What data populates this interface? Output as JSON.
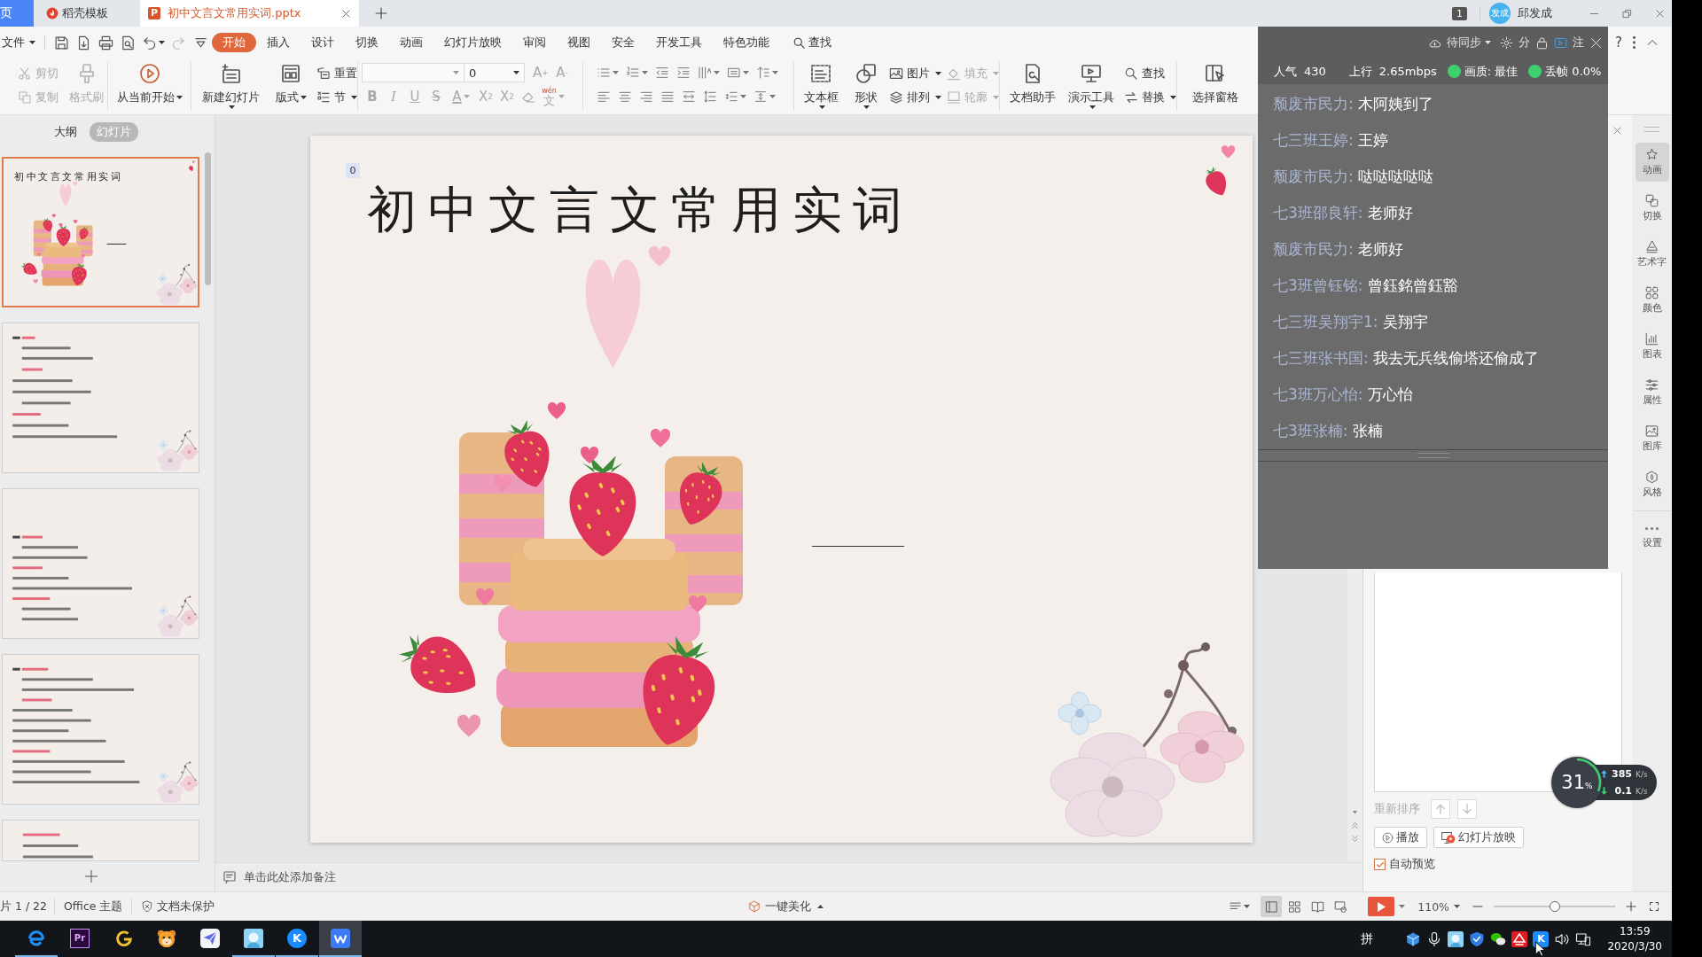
{
  "tabs": [
    {
      "kind": "home",
      "label": "页",
      "selected": false
    },
    {
      "kind": "docer",
      "label": "稻壳模板",
      "selected": false
    },
    {
      "kind": "pptx",
      "glyph": "P",
      "label": "初中文言文常用实词.pptx",
      "selected": true
    }
  ],
  "account": {
    "count": "1",
    "avatar": "发成",
    "name": "邱发成"
  },
  "menu": {
    "file": "文件",
    "tabs": [
      {
        "label": "开始",
        "selected": true
      },
      {
        "label": "插入",
        "selected": false
      },
      {
        "label": "设计",
        "selected": false
      },
      {
        "label": "切换",
        "selected": false
      },
      {
        "label": "动画",
        "selected": false
      },
      {
        "label": "幻灯片放映",
        "selected": false
      },
      {
        "label": "审阅",
        "selected": false
      },
      {
        "label": "视图",
        "selected": false
      },
      {
        "label": "安全",
        "selected": false
      },
      {
        "label": "开发工具",
        "selected": false
      },
      {
        "label": "特色功能",
        "selected": false
      }
    ],
    "search": "查找",
    "sync_status": "待同步",
    "share": "分",
    "comments": "注",
    "help": "?"
  },
  "ribbon": [
    [
      {
        "kind": "stack",
        "items": [
          {
            "label": "剪切",
            "disabled": true,
            "caret": false
          },
          {
            "label": "复制",
            "disabled": true,
            "caret": false
          }
        ]
      },
      {
        "kind": "large",
        "label": "格式刷",
        "disabled": true,
        "caret": false
      }
    ],
    [
      {
        "kind": "large",
        "label": "从当前开始",
        "disabled": false,
        "caret": true
      }
    ],
    [
      {
        "kind": "large",
        "label": "新建幻灯片",
        "disabled": false,
        "caret": true
      },
      {
        "kind": "large",
        "label": "版式",
        "disabled": false,
        "caret": true
      },
      {
        "kind": "stack",
        "items": [
          {
            "label": "重置",
            "disabled": false,
            "caret": false
          },
          {
            "label": "节",
            "disabled": false,
            "caret": true
          }
        ]
      }
    ],
    [
      {
        "kind": "font",
        "disabled": true,
        "size": "0",
        "grow": {
          "glyph": "A",
          "index": "+"
        },
        "shrink": {
          "glyph": "A",
          "index": "-"
        },
        "styles": [
          {
            "kind": "bold",
            "glyph": "B"
          },
          {
            "kind": "italic",
            "glyph": "I"
          },
          {
            "kind": "underline",
            "glyph": "U"
          },
          {
            "kind": "strike",
            "glyph": "S"
          },
          {
            "kind": "color",
            "glyph": "A"
          },
          {
            "kind": "sup",
            "glyph": "X",
            "index": "2"
          },
          {
            "kind": "sub",
            "glyph": "X",
            "index": "2"
          },
          {
            "kind": "eraser"
          },
          {
            "kind": "phonetic",
            "glyph": "文",
            "ruby": "wén"
          }
        ]
      }
    ],
    [
      {
        "kind": "paragraph"
      }
    ],
    [
      {
        "kind": "large",
        "label": "文本框",
        "disabled": false,
        "caret": true
      },
      {
        "kind": "large",
        "label": "形状",
        "disabled": false,
        "caret": true
      },
      {
        "kind": "stack",
        "items": [
          {
            "label": "图片",
            "disabled": false,
            "caret": true
          },
          {
            "label": "排列",
            "disabled": false,
            "caret": true
          }
        ]
      },
      {
        "kind": "stack",
        "items": [
          {
            "label": "填充",
            "disabled": true,
            "caret": true
          },
          {
            "label": "轮廓",
            "disabled": true,
            "caret": true
          }
        ]
      }
    ],
    [
      {
        "kind": "large",
        "label": "文档助手",
        "disabled": false,
        "caret": false
      },
      {
        "kind": "large",
        "label": "演示工具",
        "disabled": false,
        "caret": true
      },
      {
        "kind": "stack",
        "items": [
          {
            "label": "查找",
            "disabled": false,
            "caret": false
          },
          {
            "label": "替换",
            "disabled": false,
            "caret": true
          }
        ]
      }
    ],
    [
      {
        "kind": "large",
        "label": "选择窗格",
        "disabled": false,
        "caret": false
      }
    ]
  ],
  "slides_panel": {
    "tabs": [
      {
        "label": "大纲",
        "selected": false
      },
      {
        "label": "幻灯片",
        "selected": true
      }
    ],
    "thumbnails": [
      {
        "kind": "title",
        "title": "初中文言文常用实词",
        "selected": true
      },
      {
        "kind": "notes",
        "selected": false
      },
      {
        "kind": "notes",
        "selected": false
      },
      {
        "kind": "notes",
        "selected": false
      },
      {
        "kind": "notes",
        "selected": false
      }
    ]
  },
  "slide": {
    "badge": "0",
    "title": "初中文言文常用实词"
  },
  "notes": {
    "hint": "单击此处添加备注"
  },
  "task_pane": {
    "reorder": {
      "label": "重新排序",
      "disabled": true
    },
    "buttons": [
      {
        "kind": "play",
        "label": "播放"
      },
      {
        "kind": "slideshow",
        "label": "幻灯片放映"
      }
    ],
    "auto_preview": {
      "label": "自动预览",
      "checked": true
    }
  },
  "sidebar": [
    {
      "kind": "animation",
      "label": "动画",
      "selected": true
    },
    {
      "kind": "transition",
      "label": "切换",
      "selected": false
    },
    {
      "kind": "wordart",
      "label": "艺术字",
      "selected": false
    },
    {
      "kind": "colors",
      "label": "颜色",
      "selected": false
    },
    {
      "kind": "chart",
      "label": "图表",
      "selected": false
    },
    {
      "kind": "properties",
      "label": "属性",
      "selected": false
    },
    {
      "kind": "gallery",
      "label": "图库",
      "selected": false
    },
    {
      "kind": "style",
      "label": "风格",
      "selected": false
    },
    {
      "kind": "settings",
      "label": "设置",
      "selected": false
    }
  ],
  "live_panel": {
    "stats": [
      {
        "kind": "text",
        "label": "人气",
        "value": "430"
      },
      {
        "kind": "text",
        "label": "上行",
        "value": "2.65mbps"
      },
      {
        "kind": "dot",
        "label": "画质: 最佳",
        "color": "#3fd06e"
      },
      {
        "kind": "dot",
        "label": "丢帧 0.0%",
        "color": "#3fd06e"
      }
    ],
    "messages": [
      {
        "name": "颓废市民力:",
        "text": "木阿姨到了"
      },
      {
        "name": "七三班王婷:",
        "text": "王婷"
      },
      {
        "name": "颓废市民力:",
        "text": "哒哒哒哒哒"
      },
      {
        "name": "七3班邵良轩:",
        "text": "老师好"
      },
      {
        "name": "颓废市民力:",
        "text": "老师好"
      },
      {
        "name": "七3班曾钰铭:",
        "text": "曾鈺銘曾鈺豁"
      },
      {
        "name": "七三班吴翔宇1:",
        "text": "吴翔宇"
      },
      {
        "name": "七三班张书国:",
        "text": "我去无兵线偷塔还偷成了"
      },
      {
        "name": "七3班万心怡:",
        "text": "万心怡"
      },
      {
        "name": "七3班张楠:",
        "text": "张楠"
      }
    ]
  },
  "speed_widget": {
    "percent": "31",
    "unit": "%",
    "level": 0.31,
    "up": {
      "value": "385",
      "unit": "K/s"
    },
    "down": {
      "value": "0.1",
      "unit": "K/s"
    }
  },
  "status_bar": {
    "page": "片 1 / 22",
    "theme": "Office 主题",
    "protection": "文档未保护",
    "beautify": "一键美化",
    "views": [
      {
        "kind": "normal",
        "selected": true
      },
      {
        "kind": "sorter",
        "selected": false
      },
      {
        "kind": "reading",
        "selected": false
      },
      {
        "kind": "presenter",
        "selected": false
      }
    ],
    "zoom": "110%",
    "zoom_slider": {
      "level": 0.5
    }
  },
  "taskbar": {
    "apps": [
      {
        "kind": "edge",
        "running": true,
        "active": false
      },
      {
        "kind": "premiere",
        "glyph": "Pr",
        "running": false,
        "active": false
      },
      {
        "kind": "swirl",
        "running": false,
        "active": false
      },
      {
        "kind": "bear",
        "running": false,
        "active": false
      },
      {
        "kind": "plane",
        "running": false,
        "active": false
      },
      {
        "kind": "tile",
        "running": true,
        "active": false
      },
      {
        "kind": "k",
        "glyph": "K",
        "running": true,
        "active": false
      },
      {
        "kind": "wps",
        "running": true,
        "active": true
      }
    ],
    "ime": "拼",
    "tray": [
      {
        "kind": "cube"
      },
      {
        "kind": "mic"
      },
      {
        "kind": "tile"
      },
      {
        "kind": "shield"
      },
      {
        "kind": "chat"
      },
      {
        "kind": "red"
      },
      {
        "kind": "k",
        "glyph": "K"
      },
      {
        "kind": "speaker"
      },
      {
        "kind": "network"
      }
    ],
    "time": "13:59",
    "date": "2020/3/30"
  }
}
